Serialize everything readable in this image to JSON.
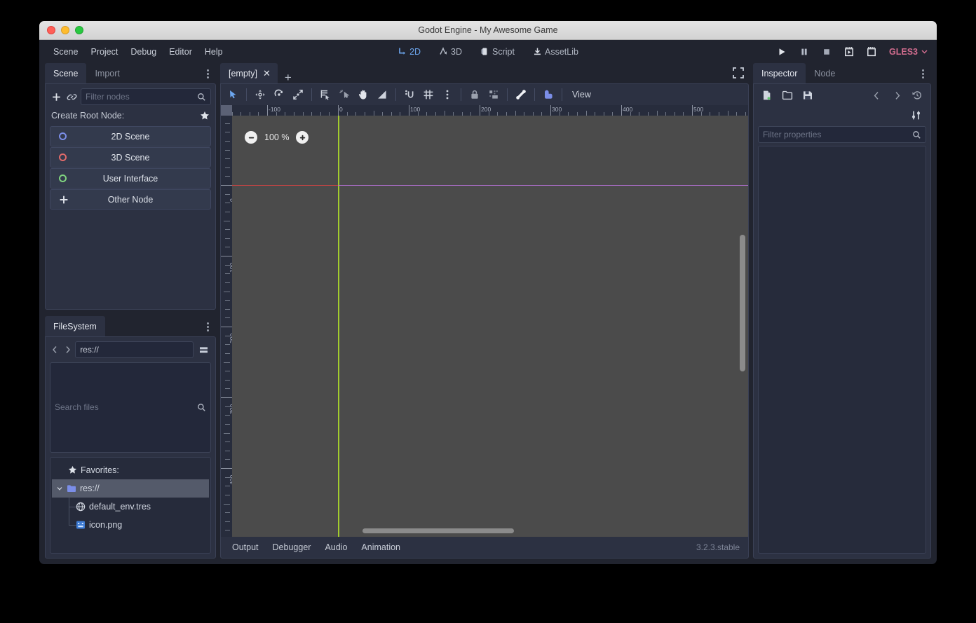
{
  "window": {
    "title": "Godot Engine - My Awesome Game"
  },
  "menubar": {
    "items": [
      "Scene",
      "Project",
      "Debug",
      "Editor",
      "Help"
    ],
    "center_tabs": [
      {
        "label": "2D",
        "icon": "2d-icon",
        "active": true
      },
      {
        "label": "3D",
        "icon": "3d-icon",
        "active": false
      },
      {
        "label": "Script",
        "icon": "script-icon",
        "active": false
      },
      {
        "label": "AssetLib",
        "icon": "assetlib-icon",
        "active": false
      }
    ],
    "playback": [
      {
        "name": "play-button",
        "icon": "play-icon"
      },
      {
        "name": "pause-button",
        "icon": "pause-icon"
      },
      {
        "name": "stop-button",
        "icon": "stop-icon"
      },
      {
        "name": "play-scene-button",
        "icon": "play-scene-icon"
      },
      {
        "name": "play-custom-scene-button",
        "icon": "play-custom-scene-icon"
      }
    ],
    "renderer": {
      "label": "GLES3",
      "color": "#d06c8e"
    }
  },
  "scene_panel": {
    "tabs": [
      {
        "label": "Scene",
        "active": true
      },
      {
        "label": "Import",
        "active": false
      }
    ],
    "toolbar": {
      "add_node": "+",
      "instance_scene": "link-icon"
    },
    "filter": {
      "placeholder": "Filter nodes",
      "value": ""
    },
    "create_root_label": "Create Root Node:",
    "root_options": [
      {
        "label": "2D Scene",
        "icon": "ring-blue-icon",
        "color": "#7b8ee8"
      },
      {
        "label": "3D Scene",
        "icon": "ring-red-icon",
        "color": "#e06a6a"
      },
      {
        "label": "User Interface",
        "icon": "ring-green-icon",
        "color": "#7fd37f"
      },
      {
        "label": "Other Node",
        "icon": "plus-icon",
        "color": "#dfe3ea"
      }
    ]
  },
  "filesystem_panel": {
    "tab": "FileSystem",
    "path": {
      "value": "res://"
    },
    "search": {
      "placeholder": "Search files",
      "value": ""
    },
    "tree": [
      {
        "label": "Favorites:",
        "icon": "star-icon",
        "depth": 0,
        "selected": false
      },
      {
        "label": "res://",
        "icon": "folder-icon",
        "depth": 0,
        "selected": true,
        "expanded": true
      },
      {
        "label": "default_env.tres",
        "icon": "environment-icon",
        "depth": 1,
        "selected": false
      },
      {
        "label": "icon.png",
        "icon": "image-icon",
        "depth": 1,
        "selected": false
      }
    ]
  },
  "viewport": {
    "tab": {
      "label": "[empty]",
      "close": "✕"
    },
    "add_tab": "+",
    "expand": "distraction-free-icon",
    "toolbar": {
      "tools": [
        "select-mode-icon",
        "move-mode-icon",
        "rotate-mode-icon",
        "scale-mode-icon",
        "list-select-icon",
        "click-select-icon",
        "pan-mode-icon",
        "ruler-mode-icon",
        "snap-mode-icon",
        "snap-config-icon",
        "more-options-icon",
        "lock-icon",
        "group-icon",
        "skeleton-icon",
        "animation-key-icon"
      ],
      "view_menu": "View"
    },
    "zoom": {
      "value": "100 %",
      "minus": "−",
      "plus": "+"
    },
    "ruler_h_labels": [
      "-100",
      "0",
      "100",
      "200",
      "300",
      "400",
      "500"
    ],
    "ruler_v_labels": [
      "0",
      "100",
      "200",
      "300",
      "400"
    ],
    "guides": {
      "y_axis_color": "#a2cc2d",
      "x_axis_left_color": "#cc4343",
      "x_axis_right_color": "#b06fcf"
    }
  },
  "bottom_panel": {
    "items": [
      "Output",
      "Debugger",
      "Audio",
      "Animation"
    ],
    "version": "3.2.3.stable"
  },
  "inspector_panel": {
    "tabs": [
      {
        "label": "Inspector",
        "active": true
      },
      {
        "label": "Node",
        "active": false
      }
    ],
    "toolbar": [
      "new-resource-icon",
      "load-resource-icon",
      "save-resource-icon",
      "history-back-icon",
      "history-forward-icon",
      "history-icon"
    ],
    "object_tools": "object-tools-icon",
    "filter": {
      "placeholder": "Filter properties",
      "value": ""
    }
  }
}
